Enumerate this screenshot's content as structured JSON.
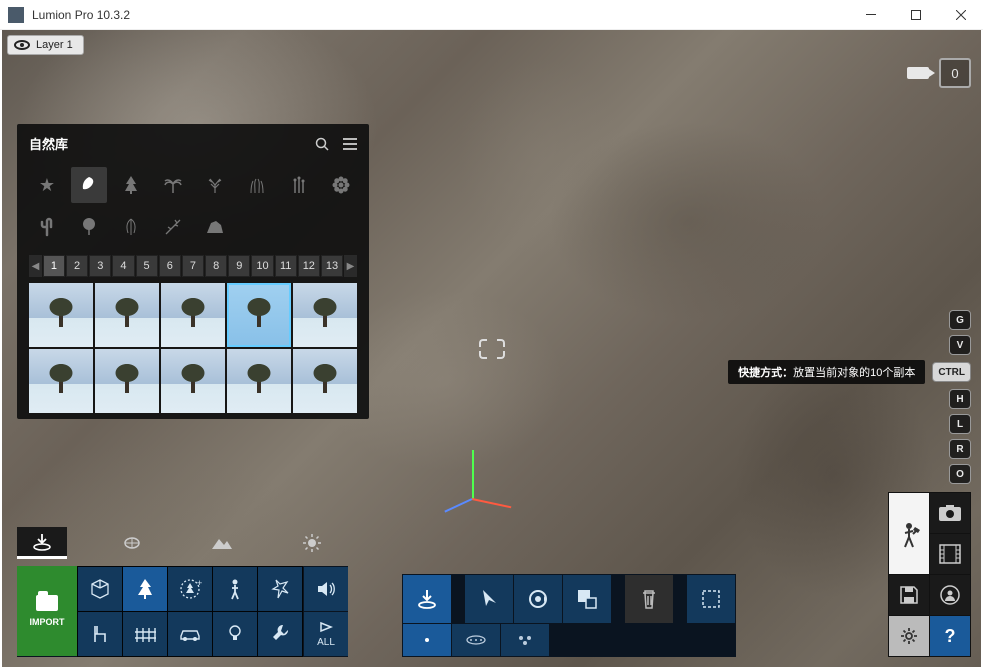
{
  "app": {
    "title": "Lumion Pro 10.3.2"
  },
  "layer": {
    "label": "Layer 1"
  },
  "topright": {
    "counter": "0"
  },
  "library": {
    "title": "自然库",
    "pages": [
      "1",
      "2",
      "3",
      "4",
      "5",
      "6",
      "7",
      "8",
      "9",
      "10",
      "11",
      "12",
      "13"
    ],
    "active_page": 0,
    "selected_thumb": 3
  },
  "toolbar_left": {
    "import_label": "IMPORT",
    "all_label": "ALL"
  },
  "hint": {
    "prefix": "快捷方式：",
    "text": "放置当前对象的10个副本",
    "ctrl": "CTRL"
  },
  "keys": [
    "G",
    "V",
    "H",
    "L",
    "R",
    "O"
  ],
  "mode": {
    "help": "?"
  }
}
